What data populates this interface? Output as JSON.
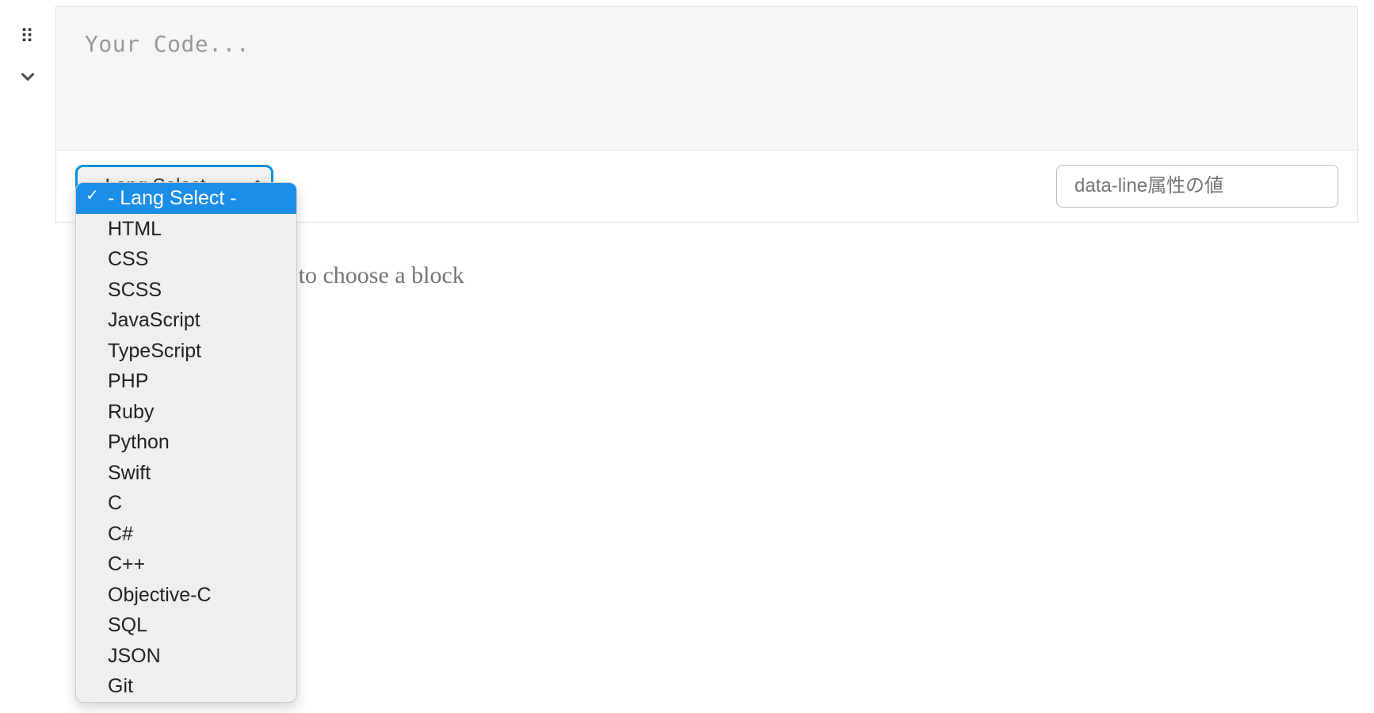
{
  "block": {
    "code_placeholder": "Your Code...",
    "lang_select": {
      "selected": " - Lang Select - ",
      "options": [
        " - Lang Select - ",
        "HTML",
        "CSS",
        "SCSS",
        "JavaScript",
        "TypeScript",
        "PHP",
        "Ruby",
        "Python",
        "Swift",
        "C",
        "C#",
        "C++",
        "Objective-C",
        "SQL",
        "JSON",
        "Git"
      ]
    },
    "data_line": {
      "placeholder": "data-line属性の値"
    }
  },
  "editor": {
    "new_block_hint": "ype / to choose a block"
  }
}
